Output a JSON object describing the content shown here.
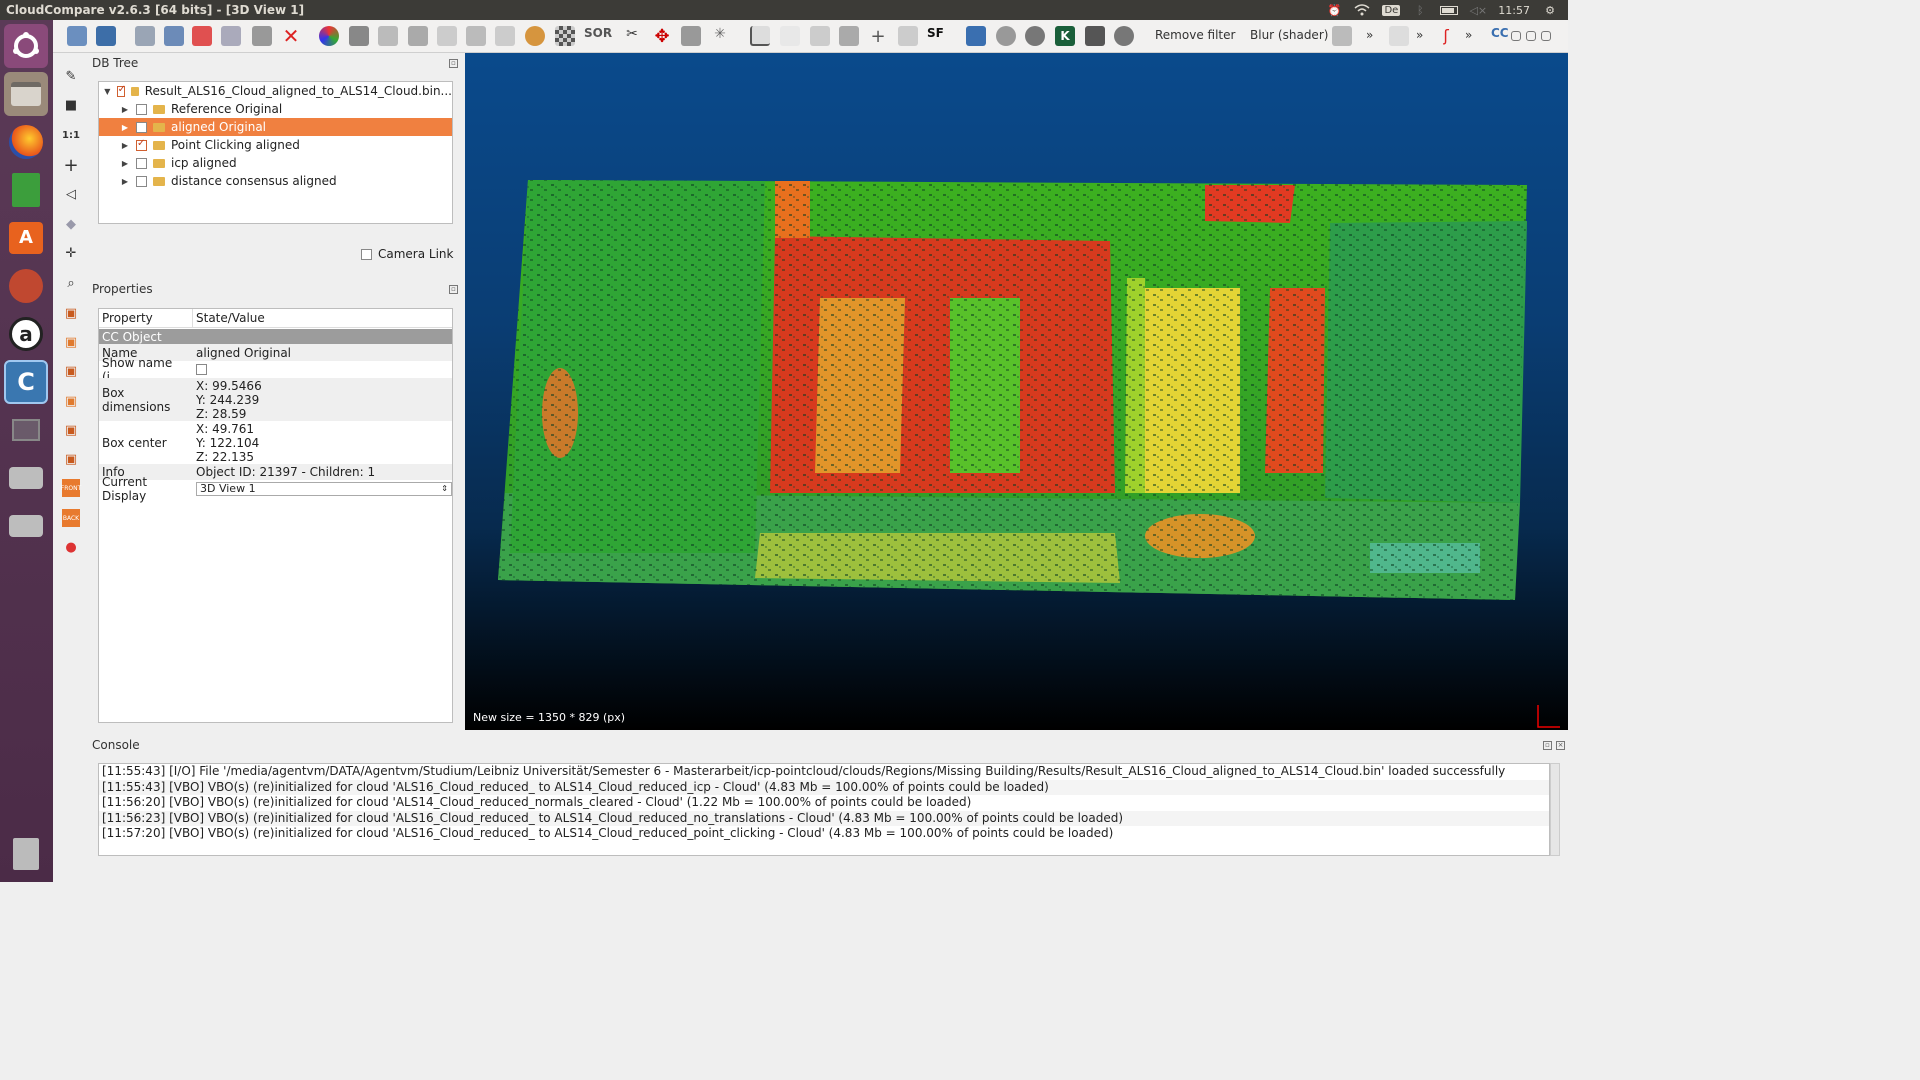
{
  "window": {
    "title": "CloudCompare v2.6.3 [64 bits] - [3D View 1]"
  },
  "system_tray": {
    "keyboard": "De",
    "time": "11:57"
  },
  "toolbar": {
    "remove_filter": "Remove filter",
    "blur_shader": "Blur (shader)",
    "more": "»",
    "sf_label": "SF",
    "sor_label": "SOR"
  },
  "vtool": {
    "one_to_one": "1:1",
    "front": "FRONT",
    "back": "BACK"
  },
  "db_tree": {
    "title": "DB Tree",
    "items": [
      {
        "label": "Result_ALS16_Cloud_aligned_to_ALS14_Cloud.bin...",
        "checked": true
      },
      {
        "label": "Reference Original",
        "checked": false
      },
      {
        "label": "aligned Original",
        "checked": false,
        "selected": true
      },
      {
        "label": "Point Clicking aligned",
        "checked": true
      },
      {
        "label": "icp aligned",
        "checked": false
      },
      {
        "label": "distance consensus aligned",
        "checked": false
      }
    ],
    "camera_link": "Camera Link"
  },
  "properties": {
    "title": "Properties",
    "header": {
      "property": "Property",
      "value": "State/Value"
    },
    "group": "CC Object",
    "name_label": "Name",
    "name_value": "aligned Original",
    "show_name_label": "Show name (i...",
    "box_dim_label": "Box dimensions",
    "box_dim": {
      "x": "X: 99.5466",
      "y": "Y: 244.239",
      "z": "Z: 28.59"
    },
    "box_center_label": "Box center",
    "box_center": {
      "x": "X: 49.761",
      "y": "Y: 122.104",
      "z": "Z: 22.135"
    },
    "info_label": "Info",
    "info_value": "Object ID: 21397 - Children: 1",
    "display_label": "Current Display",
    "display_value": "3D View 1"
  },
  "view3d": {
    "new_size": "New size = 1350 * 829 (px)"
  },
  "console": {
    "title": "Console",
    "lines": [
      "[11:55:43] [I/O] File '/media/agentvm/DATA/Agentvm/Studium/Leibniz Universität/Semester 6 - Masterarbeit/icp-pointcloud/clouds/Regions/Missing Building/Results/Result_ALS16_Cloud_aligned_to_ALS14_Cloud.bin' loaded successfully",
      "[11:55:43] [VBO] VBO(s) (re)initialized for cloud 'ALS16_Cloud_reduced_ to ALS14_Cloud_reduced_icp - Cloud' (4.83 Mb = 100.00% of points could be loaded)",
      "[11:56:20] [VBO] VBO(s) (re)initialized for cloud 'ALS14_Cloud_reduced_normals_cleared - Cloud' (1.22 Mb = 100.00% of points could be loaded)",
      "[11:56:23] [VBO] VBO(s) (re)initialized for cloud 'ALS16_Cloud_reduced_ to ALS14_Cloud_reduced_no_translations - Cloud' (4.83 Mb = 100.00% of points could be loaded)",
      "[11:57:20] [VBO] VBO(s) (re)initialized for cloud 'ALS16_Cloud_reduced_ to ALS14_Cloud_reduced_point_clicking - Cloud' (4.83 Mb = 100.00% of points could be loaded)"
    ]
  }
}
